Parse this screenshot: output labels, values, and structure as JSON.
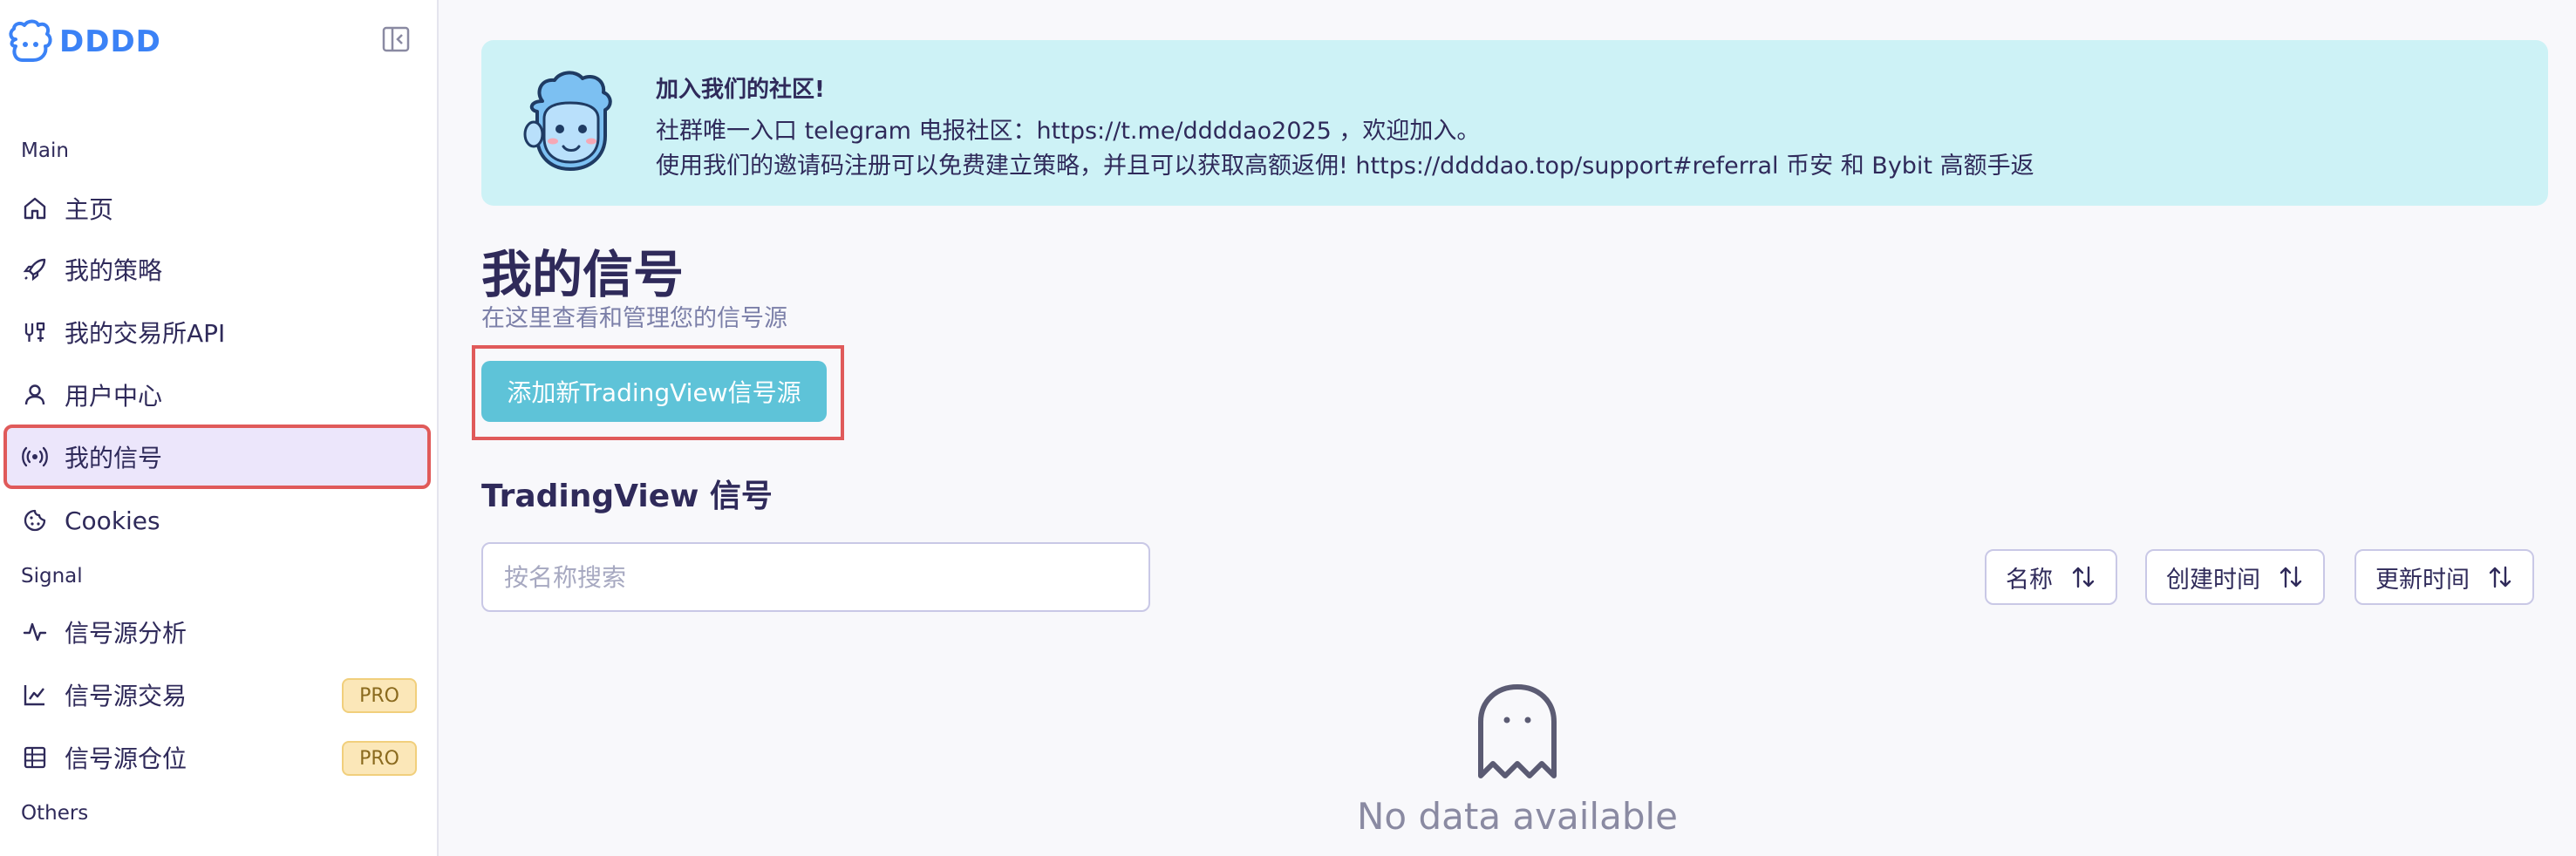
{
  "brand": {
    "name": "DDDD",
    "accent": "#3b82f6"
  },
  "sidebar": {
    "sections": {
      "main": "Main",
      "signal": "Signal",
      "others": "Others"
    },
    "items": [
      {
        "label": "主页",
        "icon": "home-icon"
      },
      {
        "label": "我的策略",
        "icon": "rocket-icon"
      },
      {
        "label": "我的交易所API",
        "icon": "exchange-api-icon"
      },
      {
        "label": "用户中心",
        "icon": "user-icon"
      },
      {
        "label": "我的信号",
        "icon": "broadcast-icon",
        "active": true
      },
      {
        "label": "Cookies",
        "icon": "cookie-icon"
      },
      {
        "label": "信号源分析",
        "icon": "pulse-icon"
      },
      {
        "label": "信号源交易",
        "icon": "chart-line-icon",
        "badge": "PRO"
      },
      {
        "label": "信号源仓位",
        "icon": "table-icon",
        "badge": "PRO"
      }
    ]
  },
  "banner": {
    "title": "加入我们的社区!",
    "line1": "社群唯一入口 telegram 电报社区：https://t.me/ddddao2025 ，欢迎加入。",
    "line2": "使用我们的邀请码注册可以免费建立策略，并且可以获取高额返佣! https://ddddao.top/support#referral 币安 和 Bybit 高额手返"
  },
  "page": {
    "title": "我的信号",
    "subtitle": "在这里查看和管理您的信号源",
    "add_button": "添加新TradingView信号源",
    "section_title": "TradingView 信号",
    "search_placeholder": "按名称搜索",
    "sort": {
      "name": "名称",
      "created": "创建时间",
      "updated": "更新时间"
    },
    "empty_text": "No data available"
  }
}
